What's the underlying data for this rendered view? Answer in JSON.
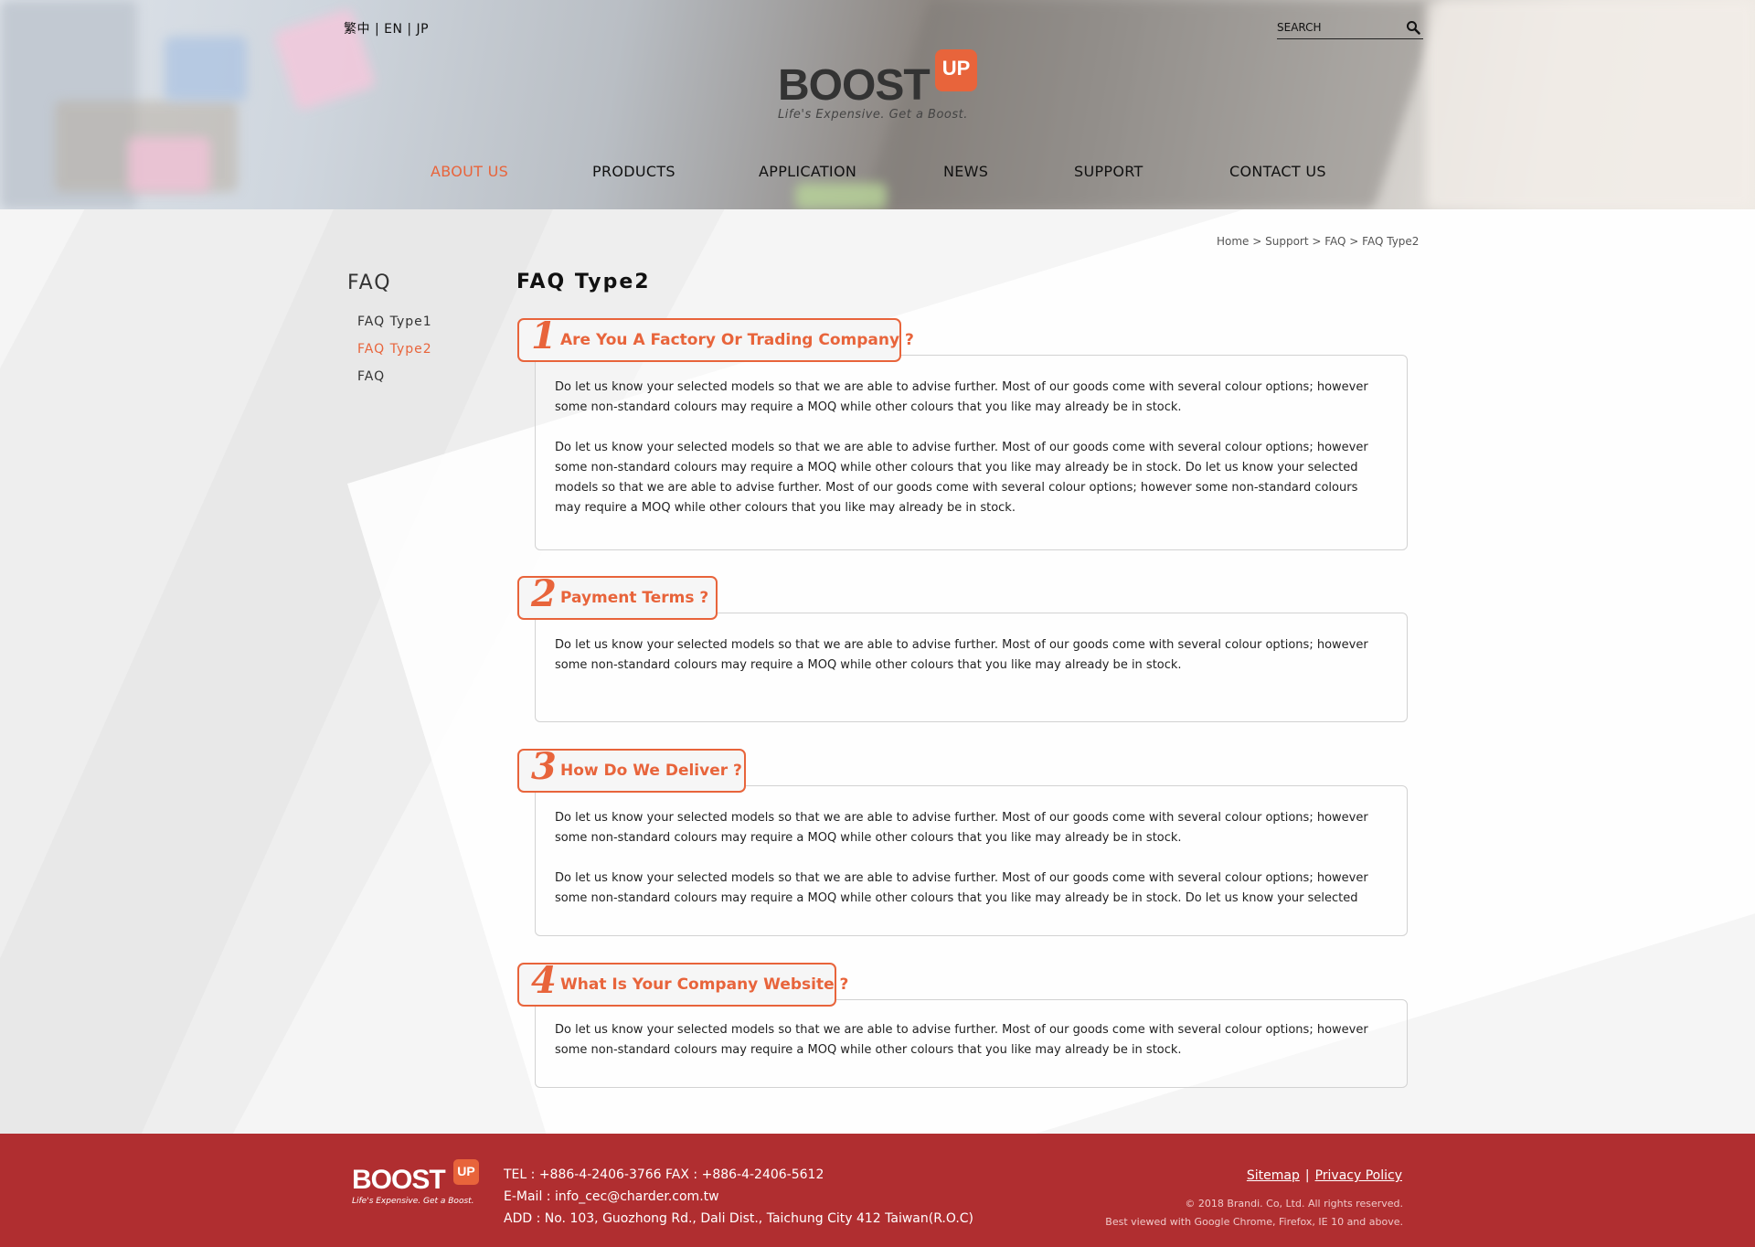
{
  "header": {
    "lang_switch": "繁中 | EN | JP",
    "search_placeholder": "SEARCH",
    "logo": {
      "word": "BOOST",
      "badge": "UP",
      "tagline": "Life's Expensive. Get a Boost."
    },
    "nav": [
      "ABOUT US",
      "PRODUCTS",
      "APPLICATION",
      "NEWS",
      "SUPPORT",
      "CONTACT US"
    ],
    "nav_active": "ABOUT US"
  },
  "breadcrumb": "Home > Support > FAQ > FAQ Type2",
  "sidebar": {
    "title": "FAQ",
    "items": [
      {
        "label": "FAQ Type1"
      },
      {
        "label": "FAQ Type2",
        "active": true
      },
      {
        "label": "FAQ"
      }
    ]
  },
  "page_title": "FAQ Type2",
  "faqs": [
    {
      "number": "1",
      "question": "Are You A Factory Or Trading Company ?",
      "paragraphs": [
        "Do let us know your selected models so that we are able to advise further. Most of our goods come with several colour options; however some non-standard colours may require a MOQ while other colours that you like may already be in stock.",
        "Do let us know your selected models so that we are able to advise further. Most of our goods come with several colour options; however some non-standard colours may require a MOQ while other colours that you like may already be in stock. Do let us know your selected models so that we are able to advise further. Most of our goods come with several colour options; however some non-standard colours may require a MOQ while other colours that you like may already be in stock."
      ]
    },
    {
      "number": "2",
      "question": "Payment Terms ?",
      "paragraphs": [
        "Do let us know your selected models so that we are able to advise further. Most of our goods come with several colour options; however some non-standard colours may require a MOQ while other colours that you like may already be in stock."
      ]
    },
    {
      "number": "3",
      "question": "How Do We Deliver ?",
      "paragraphs": [
        "Do let us know your selected models so that we are able to advise further. Most of our goods come with several colour options; however some non-standard colours may require a MOQ while other colours that you like may already be in stock.",
        "Do let us know your selected models so that we are able to advise further. Most of our goods come with several colour options; however some non-standard colours may require a MOQ while other colours that you like may already be in stock. Do let us know your selected"
      ]
    },
    {
      "number": "4",
      "question": "What Is Your Company Website ?",
      "paragraphs": [
        "Do let us know your selected models so that we are able to advise further. Most of our goods come with several colour options; however some non-standard colours may require a MOQ while other colours that you like may already be in stock."
      ]
    }
  ],
  "footer": {
    "logo": {
      "word": "BOOST",
      "badge": "UP",
      "tagline": "Life's Expensive. Get a Boost."
    },
    "tel_fax": "TEL : +886-4-2406-3766  FAX : +886-4-2406-5612",
    "email": "E-Mail : info_cec@charder.com.tw",
    "address": "ADD : No. 103, Guozhong Rd., Dali Dist., Taichung City 412 Taiwan(R.O.C)",
    "links": [
      "Sitemap",
      "Privacy Policy"
    ],
    "separator": "|",
    "copyright": "© 2018 Brandi. Co, Ltd. All rights reserved.",
    "browser_note": "Best viewed with Google Chrome, Firefox, IE 10 and above."
  },
  "colors": {
    "accent": "#e8643b",
    "footer_bg": "#b02e30",
    "text": "#222222"
  },
  "icons": {
    "search": "search-icon"
  }
}
